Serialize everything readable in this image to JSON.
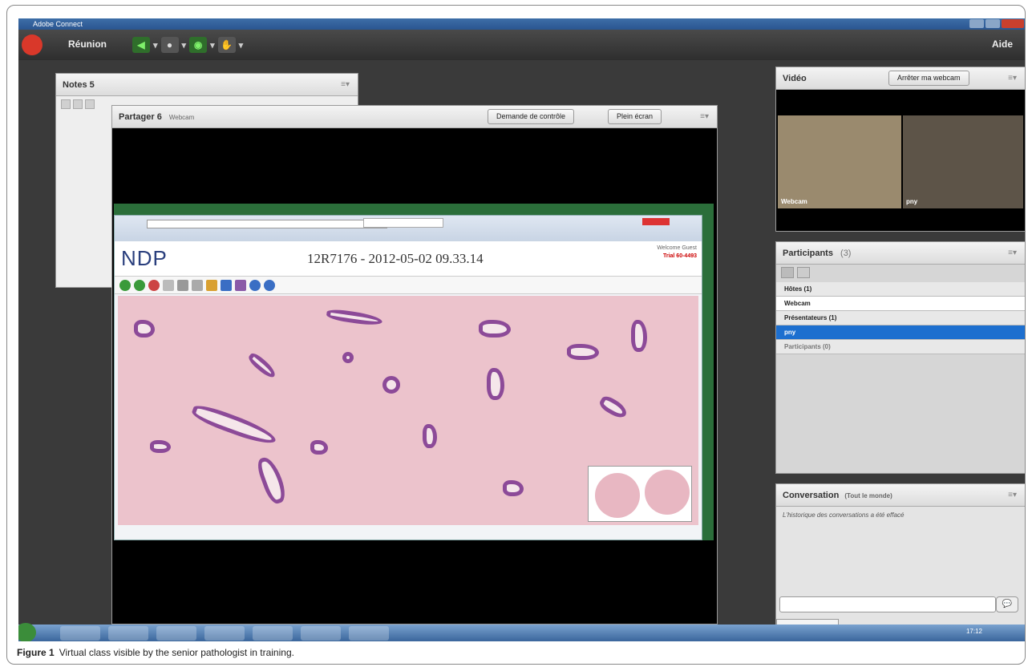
{
  "window": {
    "title": "Adobe Connect"
  },
  "menubar": {
    "meeting_label": "Réunion",
    "help_label": "Aide"
  },
  "notes_pod": {
    "title": "Notes 5"
  },
  "share_pod": {
    "title": "Partager 6",
    "subtitle": "Webcam",
    "request_control": "Demande de contrôle",
    "fullscreen": "Plein écran"
  },
  "ndp_viewer": {
    "title": "12R7176 - 2012-05-02 09.33.14",
    "welcome": "Welcome Guest",
    "trial_text": "Trial 60-4493",
    "logo": "NDP"
  },
  "video_pod": {
    "title": "Vidéo",
    "stop_webcam": "Arrêter ma webcam",
    "tile1_label": "Webcam",
    "tile2_label": "pny"
  },
  "participants_pod": {
    "title": "Participants",
    "count": "(3)",
    "hosts_header": "Hôtes (1)",
    "host_name": "Webcam",
    "presenters_header": "Présentateurs (1)",
    "presenter_name": "pny",
    "participants_header": "Participants (0)"
  },
  "chat_pod": {
    "title": "Conversation",
    "scope": "(Tout le monde)",
    "message": "L'historique des conversations a été effacé",
    "tab_label": "Tout le monde"
  },
  "taskbar": {
    "clock": "17:12"
  },
  "caption": {
    "label": "Figure 1",
    "text": "Virtual class visible by the senior pathologist in training."
  }
}
